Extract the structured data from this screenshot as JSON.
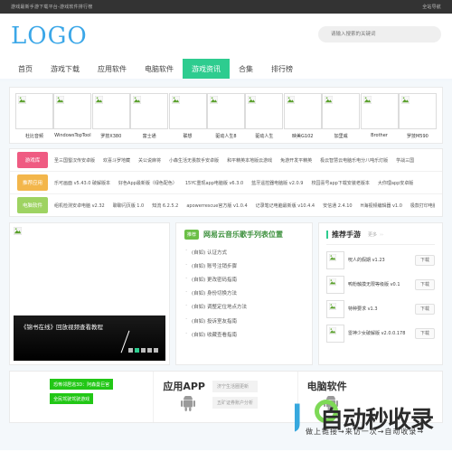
{
  "topbar": {
    "slogan": "游戏最新手游下载平台-游戏软件排行榜",
    "nav_link": "全站导航"
  },
  "header": {
    "logo": "LOGO",
    "search_placeholder": "请输入搜索的关键词"
  },
  "nav": {
    "items": [
      {
        "label": "首页",
        "active": false
      },
      {
        "label": "游戏下载",
        "active": false
      },
      {
        "label": "应用软件",
        "active": false
      },
      {
        "label": "电脑软件",
        "active": false
      },
      {
        "label": "游戏资讯",
        "active": true
      },
      {
        "label": "合集",
        "active": false
      },
      {
        "label": "排行榜",
        "active": false
      }
    ]
  },
  "thumbs": [
    {
      "caption": "杜比音频"
    },
    {
      "caption": "WindowsTopTool"
    },
    {
      "caption": "罗技X380"
    },
    {
      "caption": "富士通"
    },
    {
      "caption": "联想"
    },
    {
      "caption": "驱动人生8"
    },
    {
      "caption": "驱动人生"
    },
    {
      "caption": "映美G102"
    },
    {
      "caption": "加里威"
    },
    {
      "caption": "Brother"
    },
    {
      "caption": "罗技M590"
    }
  ],
  "tag_rows": [
    {
      "tag": "游戏库",
      "color": "#ef5b82",
      "links": [
        "圣三国蜀汉传安卓版",
        "欢喜斗罗地藏",
        "关公说麻将",
        "小森生活无畏款手安卓版",
        "和平精英本地版云游戏",
        "免游开发平精英",
        "极云智慧云电脑乐电分八吨乐灯版",
        "学战三国"
      ]
    },
    {
      "tag": "推荐应用",
      "color": "#f3b64b",
      "links": [
        "乐可画面 v5.43.0 破解版本",
        "好色App最新版（绿色配色）",
        "15YC重现app电脑版 v6.3.0",
        "蓝牙遥控器电脑版 v2.0.9",
        "校园喜号app下载安装老版本",
        "大你理app安卓版"
      ]
    },
    {
      "tag": "电脑软件",
      "color": "#9ed362",
      "links": [
        "组机检测安卓电脑 v2.32",
        "聊聊闪页版 1.0",
        "知流 6.2.5.2",
        "apowerrescue官方版 v1.0.4",
        "记录笔记电脑最新版 v10.4.4",
        "安信通 2.4.10",
        "H海视频编辑器 v1.0",
        "极款打印电脑版 v20.1.6"
      ]
    }
  ],
  "slider": {
    "caption": "《锦书在线》回放视频查看教程",
    "dots": 5,
    "active_dot": 1
  },
  "article_panel": {
    "badge": "推荐",
    "title": "网易云音乐歌手列表位置",
    "items": [
      "(自如) 认证方式",
      "(自如) 账号注销步骤",
      "(自如) 更改密码指南",
      "(自如) 身份切换方法",
      "(自如) 调整定位地点方法",
      "(自如) 投诉室友指南",
      "(自如) 收藏查看指南"
    ]
  },
  "recommend_panel": {
    "title": "推荐手游",
    "more": "更多",
    "more_arrow": "››",
    "download_label": "下载",
    "games": [
      {
        "name": "呪人的假期 v1.23"
      },
      {
        "name": "鸭粉触摸无限等级版 v0.1"
      },
      {
        "name": "特种要求 v1.3"
      },
      {
        "name": "雷神少女破解版 v2.0.0.178"
      }
    ]
  },
  "bottom": {
    "green_tags": [
      "恐怖邻居逃3D：阿森曼巨官",
      "全民驾驶驾驶游戏"
    ],
    "app_title": "应用APP",
    "gray_tags": [
      "济宁生活圈更新",
      "五矿证券账户分析"
    ],
    "third_col_label": "电脑软件"
  },
  "watermark": {
    "main_text": "自动秒收录",
    "sub_text": "做上链接→来访一次→自动收录→"
  }
}
